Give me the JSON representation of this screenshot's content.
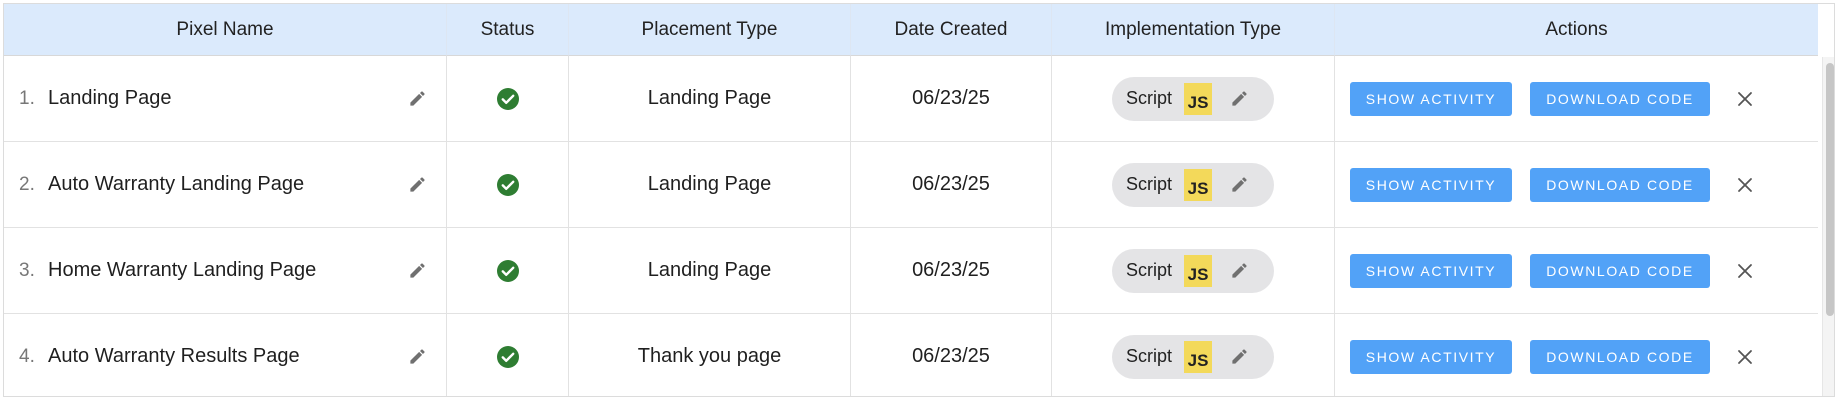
{
  "table": {
    "headers": [
      "Pixel Name",
      "Status",
      "Placement Type",
      "Date Created",
      "Implementation Type",
      "Actions"
    ],
    "rows": [
      {
        "num": "1.",
        "name": "Landing Page",
        "status": "active",
        "placement": "Landing Page",
        "date": "06/23/25",
        "implementation": "Script",
        "badge": "JS"
      },
      {
        "num": "2.",
        "name": "Auto Warranty Landing Page",
        "status": "active",
        "placement": "Landing Page",
        "date": "06/23/25",
        "implementation": "Script",
        "badge": "JS"
      },
      {
        "num": "3.",
        "name": "Home Warranty Landing Page",
        "status": "active",
        "placement": "Landing Page",
        "date": "06/23/25",
        "implementation": "Script",
        "badge": "JS"
      },
      {
        "num": "4.",
        "name": "Auto Warranty Results Page",
        "status": "active",
        "placement": "Thank you page",
        "date": "06/23/25",
        "implementation": "Script",
        "badge": "JS"
      }
    ]
  },
  "actions": {
    "show_activity": "SHOW ACTIVITY",
    "download_code": "DOWNLOAD CODE"
  },
  "icons": {
    "edit": "pencil-icon",
    "status": "check-circle-icon",
    "remove": "close-icon"
  },
  "colors": {
    "header_bg": "#dbeafc",
    "status_green": "#2e7d32",
    "button_blue": "#52a2f7",
    "js_yellow": "#f3d95a",
    "pill_bg": "#e4e4e6"
  }
}
